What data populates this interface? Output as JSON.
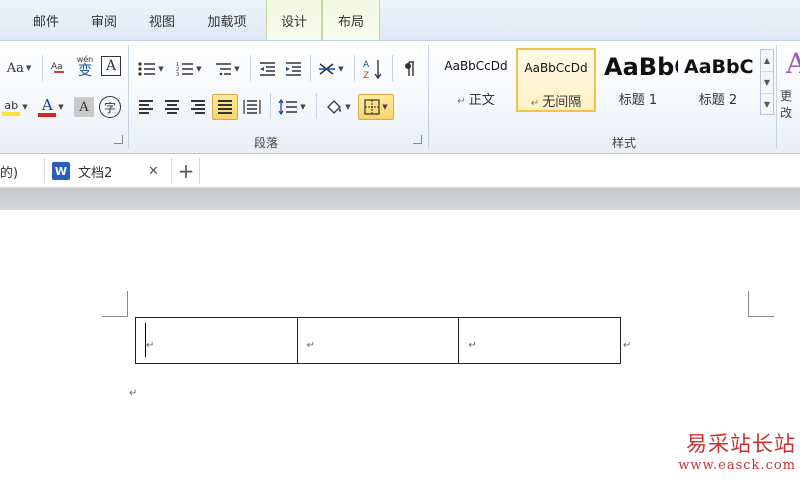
{
  "ribbon_tabs": [
    "邮件",
    "审阅",
    "视图",
    "加载项",
    "设计",
    "布局"
  ],
  "ribbon": {
    "font_group": {
      "font_size_label": "Aa",
      "phonetic_label": "wén",
      "phonetic_char": "变",
      "border_char": "A",
      "highlight_label": "ab",
      "font_color_label": "A",
      "shading_char": "A",
      "enclose_char": "字"
    },
    "paragraph_group_label": "段落",
    "styles_group_label": "样式",
    "more_styles_label": "更改",
    "styles": [
      {
        "sample": "AaBbCcDd",
        "name": "正文"
      },
      {
        "sample": "AaBbCcDd",
        "name": "无间隔"
      },
      {
        "sample": "AaBbC",
        "name": "标题 1"
      },
      {
        "sample": "AaBbC",
        "name": "标题 2"
      }
    ]
  },
  "doc_tabs": {
    "prev_tab_label": "的)",
    "active_tab_label": "文档2",
    "close_glyph": "✕",
    "new_tab_glyph": "+",
    "word_icon_letter": "W"
  },
  "document": {
    "table": {
      "columns": 3,
      "rows": 1,
      "cells": [
        "",
        "",
        ""
      ]
    }
  },
  "watermark": {
    "title": "易采站长站",
    "url": "www.easck.com"
  },
  "colors": {
    "highlight": "#f7e33c",
    "font_color": "#d22525",
    "selected_style_border": "#f0c24c",
    "watermark": "#c93232"
  }
}
